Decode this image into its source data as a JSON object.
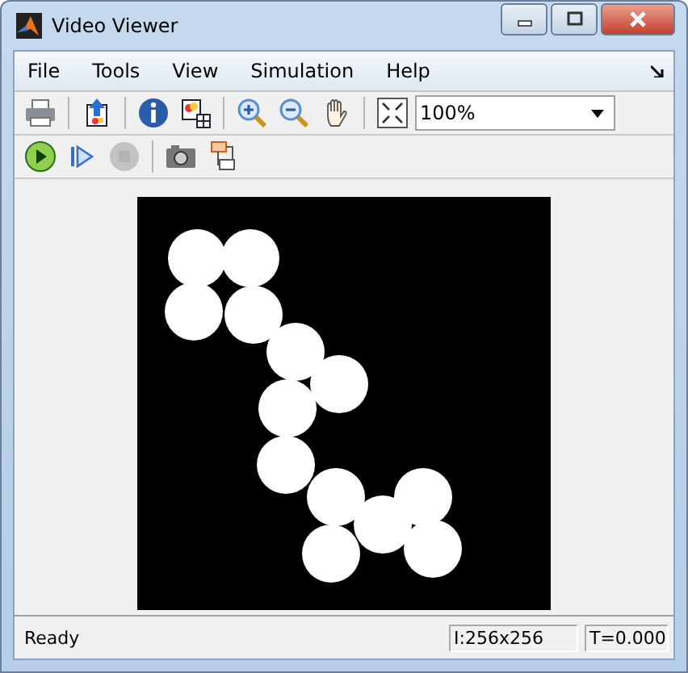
{
  "window": {
    "title": "Video Viewer"
  },
  "menu": [
    "File",
    "Tools",
    "View",
    "Simulation",
    "Help"
  ],
  "toolbar_1": [
    {
      "kind": "print",
      "disabled": false
    },
    {
      "kind": "sep"
    },
    {
      "kind": "export",
      "disabled": false
    },
    {
      "kind": "sep"
    },
    {
      "kind": "info",
      "disabled": false
    },
    {
      "kind": "palette",
      "disabled": false
    },
    {
      "kind": "sep"
    },
    {
      "kind": "zoom-in",
      "disabled": false
    },
    {
      "kind": "zoom-out",
      "disabled": false
    },
    {
      "kind": "pan",
      "disabled": false
    },
    {
      "kind": "sep"
    },
    {
      "kind": "fit",
      "disabled": false
    }
  ],
  "zoom": {
    "value": "100%"
  },
  "toolbar_2": [
    {
      "kind": "play",
      "disabled": false
    },
    {
      "kind": "step",
      "disabled": false
    },
    {
      "kind": "stop",
      "disabled": true
    },
    {
      "kind": "sep"
    },
    {
      "kind": "snapshot",
      "disabled": false
    },
    {
      "kind": "blocks",
      "disabled": false
    }
  ],
  "viewer": {
    "kind": "picture"
  },
  "status_bar": {
    "message": "Ready",
    "size": "I:256x256",
    "time": "T=0.000"
  }
}
